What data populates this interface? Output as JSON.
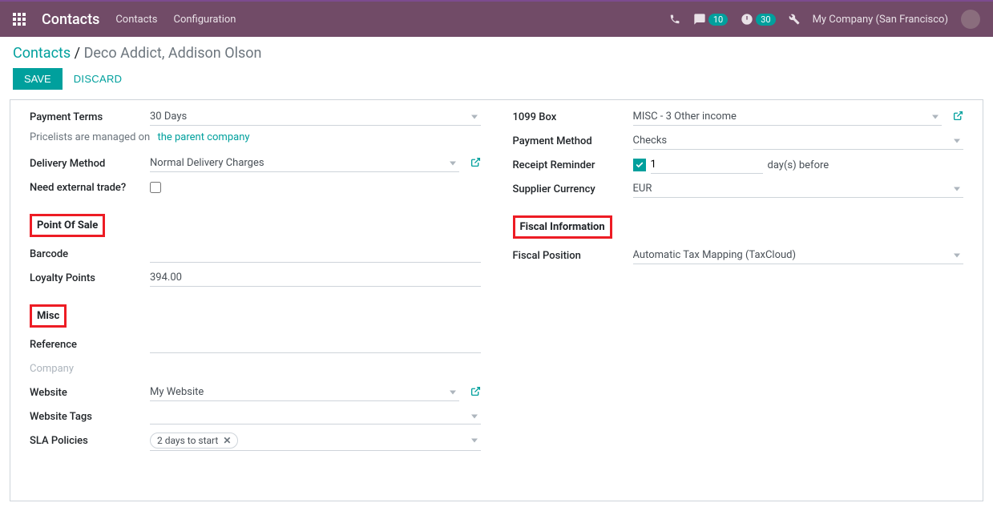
{
  "navbar": {
    "app_title": "Contacts",
    "menu": {
      "contacts": "Contacts",
      "configuration": "Configuration"
    },
    "chat_count": "10",
    "activity_count": "30",
    "company": "My Company (San Francisco)"
  },
  "breadcrumb": {
    "root": "Contacts",
    "current": "Deco Addict, Addison Olson"
  },
  "actions": {
    "save": "SAVE",
    "discard": "DISCARD"
  },
  "left": {
    "payment_terms_label": "Payment Terms",
    "payment_terms": "30 Days",
    "pricelist_note_prefix": "Pricelists are managed on",
    "pricelist_note_link": "the parent company",
    "delivery_method_label": "Delivery Method",
    "delivery_method": "Normal Delivery Charges",
    "need_external_trade_label": "Need external trade?",
    "section_pos": "Point Of Sale",
    "barcode_label": "Barcode",
    "barcode": "",
    "loyalty_label": "Loyalty Points",
    "loyalty": "394.00",
    "section_misc": "Misc",
    "reference_label": "Reference",
    "reference": "",
    "company_label": "Company",
    "website_label": "Website",
    "website": "My Website",
    "website_tags_label": "Website Tags",
    "sla_label": "SLA Policies",
    "sla_tag": "2 days to start"
  },
  "right": {
    "box1099_label": "1099 Box",
    "box1099": "MISC - 3 Other income",
    "payment_method_label": "Payment Method",
    "payment_method": "Checks",
    "receipt_reminder_label": "Receipt Reminder",
    "receipt_reminder_days": "1",
    "receipt_reminder_suffix": "day(s) before",
    "supplier_currency_label": "Supplier Currency",
    "supplier_currency": "EUR",
    "section_fiscal": "Fiscal Information",
    "fiscal_position_label": "Fiscal Position",
    "fiscal_position": "Automatic Tax Mapping (TaxCloud)"
  }
}
